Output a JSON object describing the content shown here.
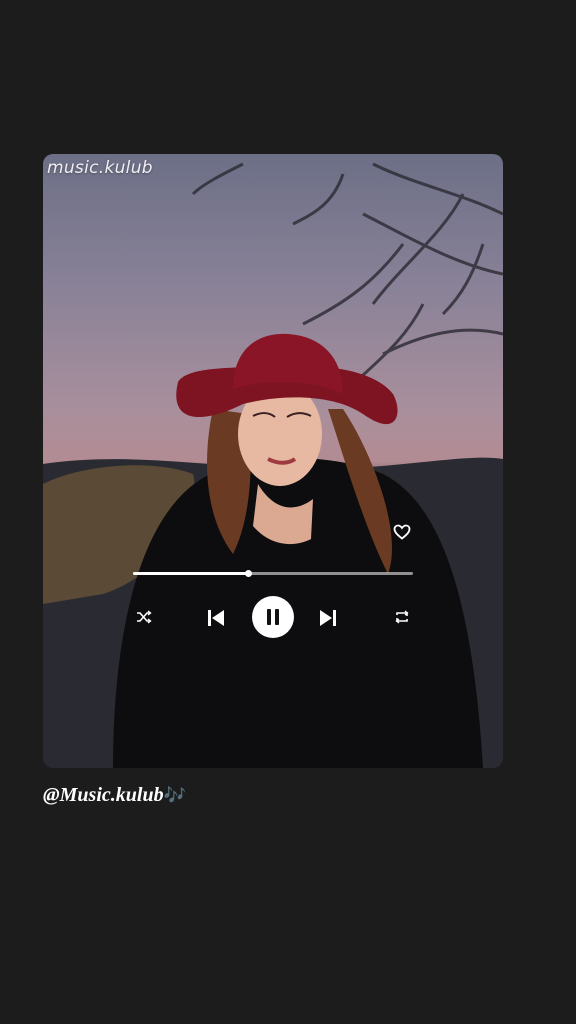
{
  "player": {
    "watermark": "music.kulub",
    "progress_fraction": 0.41,
    "controls": {
      "shuffle_icon": "shuffle-icon",
      "prev_icon": "skip-previous-icon",
      "play_icon": "pause-icon",
      "next_icon": "skip-next-icon",
      "repeat_icon": "repeat-icon",
      "like_icon": "heart-icon"
    }
  },
  "caption": {
    "handle": "@Music.kulub",
    "emoji": "🎶"
  },
  "colors": {
    "background": "#1c1c1c",
    "accent": "#ffffff",
    "hat": "#8a1526"
  }
}
